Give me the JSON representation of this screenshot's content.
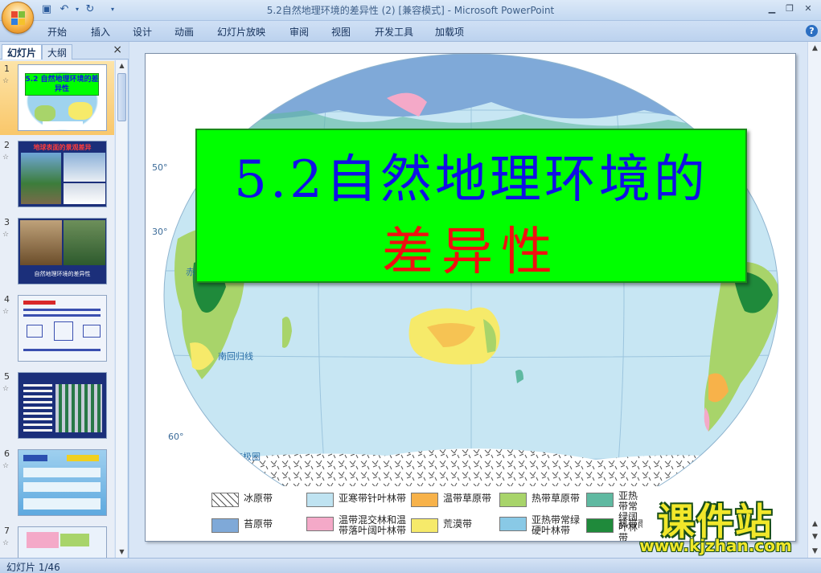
{
  "window": {
    "title": "5.2自然地理环境的差异性 (2) [兼容模式] - Microsoft PowerPoint"
  },
  "ribbon": {
    "tabs": [
      "开始",
      "插入",
      "设计",
      "动画",
      "幻灯片放映",
      "审阅",
      "视图",
      "开发工具",
      "加载项"
    ]
  },
  "panel": {
    "tabs": [
      "幻灯片",
      "大纲"
    ],
    "close_icon": "×"
  },
  "thumbnails": [
    {
      "num": "1",
      "title": "5.2 自然地理环境的差异性",
      "selected": true
    },
    {
      "num": "2",
      "title": "地球表面的景观差异",
      "selected": false
    },
    {
      "num": "3",
      "title": "自然地理环境的差异性",
      "selected": false
    },
    {
      "num": "4",
      "title": "",
      "selected": false
    },
    {
      "num": "5",
      "title": "",
      "selected": false
    },
    {
      "num": "6",
      "title": "",
      "selected": false
    },
    {
      "num": "7",
      "title": "",
      "selected": false
    }
  ],
  "slide": {
    "title_line1": "5.2自然地理环境的",
    "title_line2": "差异性",
    "map_labels": {
      "equator": "赤道",
      "tropic": "南回归线",
      "antarctic": "南极圈"
    },
    "latitudes": [
      "50°",
      "30°",
      "60°"
    ],
    "legend": [
      {
        "label": "冰原带",
        "color": "#ffffff",
        "pattern": "hatch"
      },
      {
        "label": "亚寒带针叶林带",
        "color": "#bfe3f1"
      },
      {
        "label": "温带草原带",
        "color": "#f7b24a"
      },
      {
        "label": "热带草原带",
        "color": "#a8d46a"
      },
      {
        "label": "亚热带常绿阔叶林带",
        "color": "#5fb9a1"
      },
      {
        "label": "苔原带",
        "color": "#7fa9d8"
      },
      {
        "label": "温带混交林和温带落叶阔叶林带",
        "color": "#f4a9c8"
      },
      {
        "label": "荒漠带",
        "color": "#f6ea6a"
      },
      {
        "label": "亚热带常绿硬叶林带",
        "color": "#89c9e6"
      },
      {
        "label": "热带雨林带",
        "color": "#1f8a3b"
      }
    ]
  },
  "watermark": {
    "line1": "课件站",
    "line2": "www.kjzhan.com"
  },
  "status": {
    "text": "幻灯片 1/46"
  }
}
